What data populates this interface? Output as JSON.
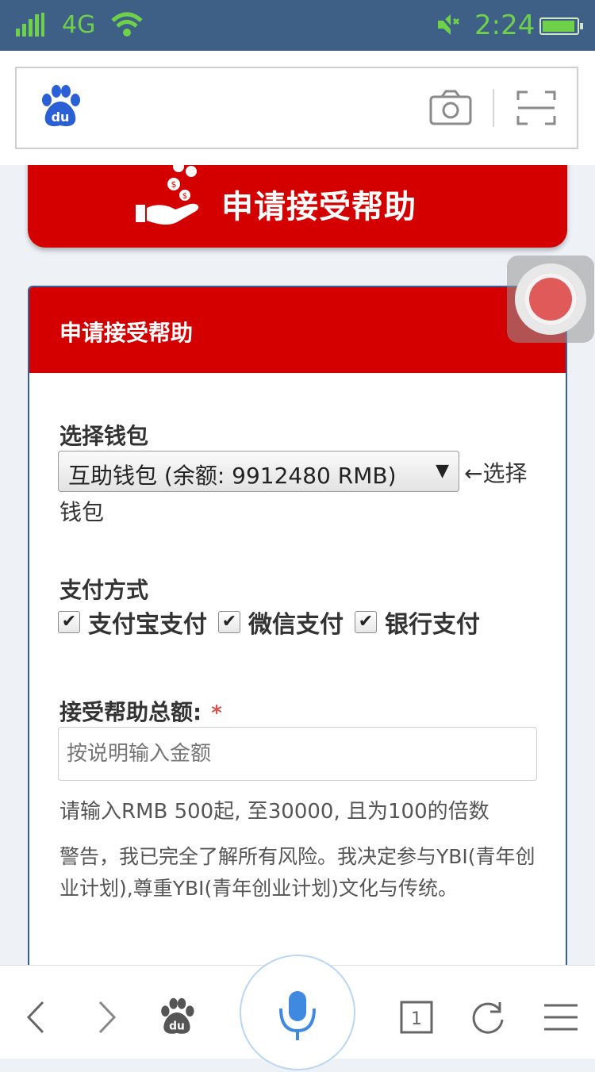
{
  "status_bar": {
    "network": "4G",
    "time": "2:24",
    "accent_color": "#6fd04a",
    "background": "#3e5f86"
  },
  "browser": {
    "logo_text": "du",
    "camera_icon": "camera-icon",
    "scan_icon": "scan-icon"
  },
  "banner": {
    "title": "申请接受帮助",
    "icon": "hand-coins-icon",
    "color": "#d40000"
  },
  "form": {
    "header_title": "申请接受帮助",
    "wallet_label": "选择钱包",
    "wallet_selected": "互助钱包 (余额: 9912480 RMB)",
    "wallet_hint": "←选择",
    "wallet_hint_cont": "钱包",
    "payment_label": "支付方式",
    "payment_options": [
      {
        "label": "支付宝支付",
        "checked": true
      },
      {
        "label": "微信支付",
        "checked": true
      },
      {
        "label": "银行支付",
        "checked": true
      }
    ],
    "amount_label": "接受帮助总额:",
    "required_mark": "*",
    "amount_placeholder": "按说明输入金额",
    "amount_help": "请输入RMB 500起, 至30000, 且为100的倍数",
    "warning": "警告，我已完全了解所有风险。我决定参与YBI(青年创业计划),尊重YBI(青年创业计划)文化与传统。"
  },
  "bottom_nav": {
    "tab_count": "1"
  }
}
